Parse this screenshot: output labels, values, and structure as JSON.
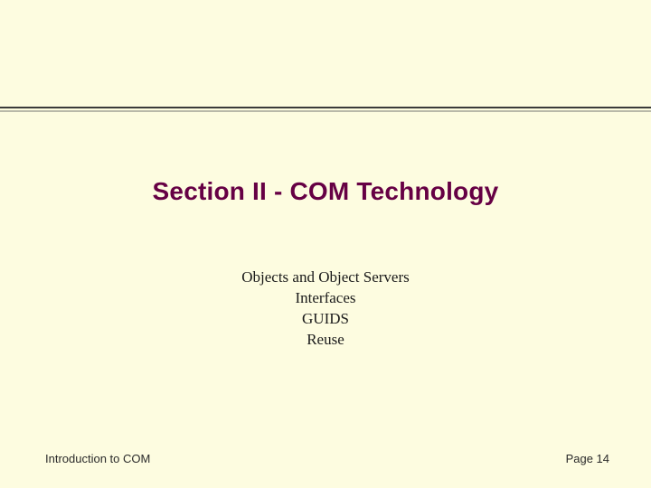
{
  "title": "Section II - COM Technology",
  "subtitles": [
    "Objects and Object Servers",
    "Interfaces",
    "GUIDS",
    "Reuse"
  ],
  "footer": {
    "left": "Introduction to COM",
    "right": "Page 14"
  },
  "colors": {
    "background": "#fdfce0",
    "title": "#660044",
    "rule_dark": "#3a3a3a",
    "rule_light": "#b9b9a9"
  }
}
